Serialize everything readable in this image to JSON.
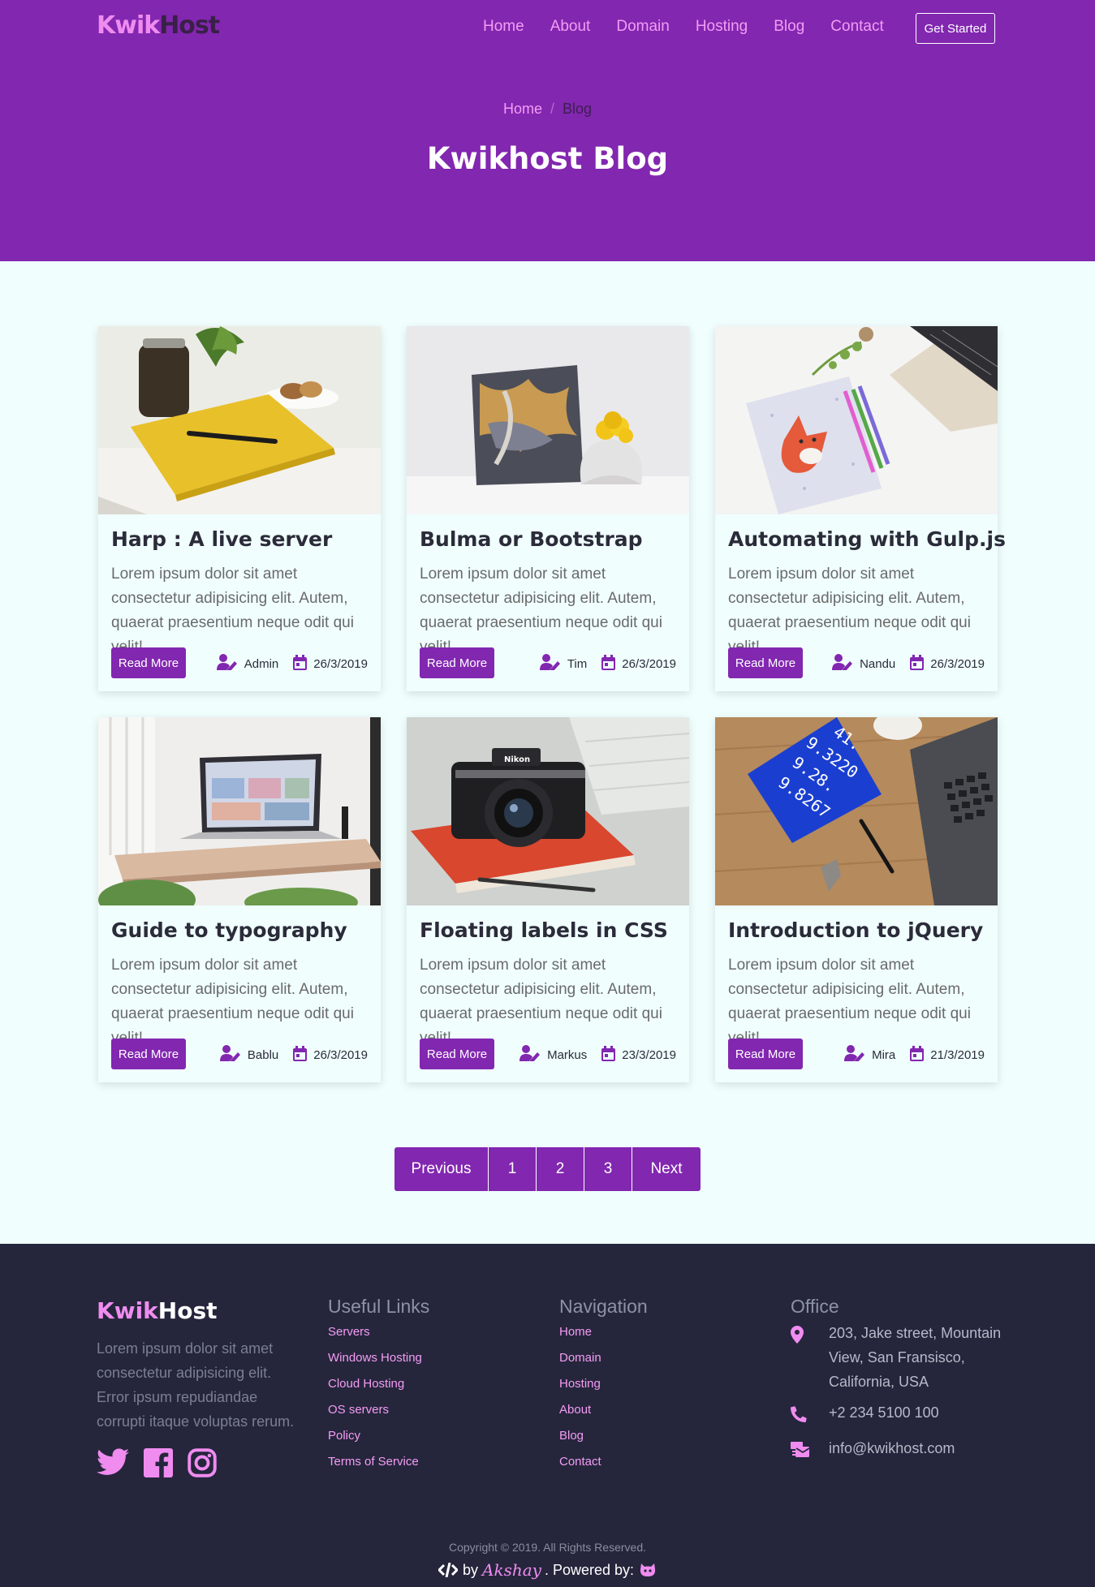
{
  "brand": {
    "part1": "Kwik",
    "part2": "Host"
  },
  "nav": {
    "items": [
      "Home",
      "About",
      "Domain",
      "Hosting",
      "Blog",
      "Contact"
    ],
    "cta": "Get Started"
  },
  "breadcrumb": {
    "home": "Home",
    "separator": "/",
    "current": "Blog"
  },
  "hero": {
    "title": "Kwikhost Blog"
  },
  "posts": [
    {
      "title": "Harp : A live server",
      "excerpt": "Lorem ipsum dolor sit amet consectetur adipisicing elit. Autem, quaerat praesentium neque odit qui velit!",
      "button": "Read More",
      "author": "Admin",
      "date": "26/3/2019"
    },
    {
      "title": "Bulma or Bootstrap",
      "excerpt": "Lorem ipsum dolor sit amet consectetur adipisicing elit. Autem, quaerat praesentium neque odit qui velit!",
      "button": "Read More",
      "author": "Tim",
      "date": "26/3/2019"
    },
    {
      "title": "Automating with Gulp.js",
      "excerpt": "Lorem ipsum dolor sit amet consectetur adipisicing elit. Autem, quaerat praesentium neque odit qui velit!",
      "button": "Read More",
      "author": "Nandu",
      "date": "26/3/2019"
    },
    {
      "title": "Guide to typography",
      "excerpt": "Lorem ipsum dolor sit amet consectetur adipisicing elit. Autem, quaerat praesentium neque odit qui velit!",
      "button": "Read More",
      "author": "Bablu",
      "date": "26/3/2019"
    },
    {
      "title": "Floating labels in CSS",
      "excerpt": "Lorem ipsum dolor sit amet consectetur adipisicing elit. Autem, quaerat praesentium neque odit qui velit!",
      "button": "Read More",
      "author": "Markus",
      "date": "23/3/2019"
    },
    {
      "title": "Introduction to jQuery",
      "excerpt": "Lorem ipsum dolor sit amet consectetur adipisicing elit. Autem, quaerat praesentium neque odit qui velit!",
      "button": "Read More",
      "author": "Mira",
      "date": "21/3/2019"
    }
  ],
  "photo_text": {
    "camera_brand": "Nikon",
    "notebook_numbers": [
      "41.",
      "9.3220",
      "9.28.",
      "9.8267"
    ]
  },
  "pagination": {
    "previous": "Previous",
    "pages": [
      "1",
      "2",
      "3"
    ],
    "next": "Next"
  },
  "footer": {
    "about": "Lorem ipsum dolor sit amet consectetur adipisicing elit. Error ipsum repudiandae corrupti itaque voluptas rerum.",
    "socials": [
      "twitter-icon",
      "facebook-icon",
      "instagram-icon"
    ],
    "useful_links": {
      "heading": "Useful Links",
      "items": [
        "Servers",
        "Windows Hosting",
        "Cloud Hosting",
        "OS servers",
        "Policy",
        "Terms of Service"
      ]
    },
    "navigation": {
      "heading": "Navigation",
      "items": [
        "Home",
        "Domain",
        "Hosting",
        "About",
        "Blog",
        "Contact"
      ]
    },
    "office": {
      "heading": "Office",
      "address": "203, Jake street, Mountain View, San Fransisco, California, USA",
      "phone": "+2 234 5100 100",
      "email": "info@kwikhost.com"
    },
    "copyright": "Copyright © 2019. All Rights Reserved.",
    "credit": {
      "by": "by",
      "author": "Akshay",
      "powered": ". Powered by:"
    }
  },
  "colors": {
    "primary": "#8227b0",
    "accent": "#f08cf0",
    "page_bg": "#f0fffe",
    "footer_bg": "#25263c"
  }
}
